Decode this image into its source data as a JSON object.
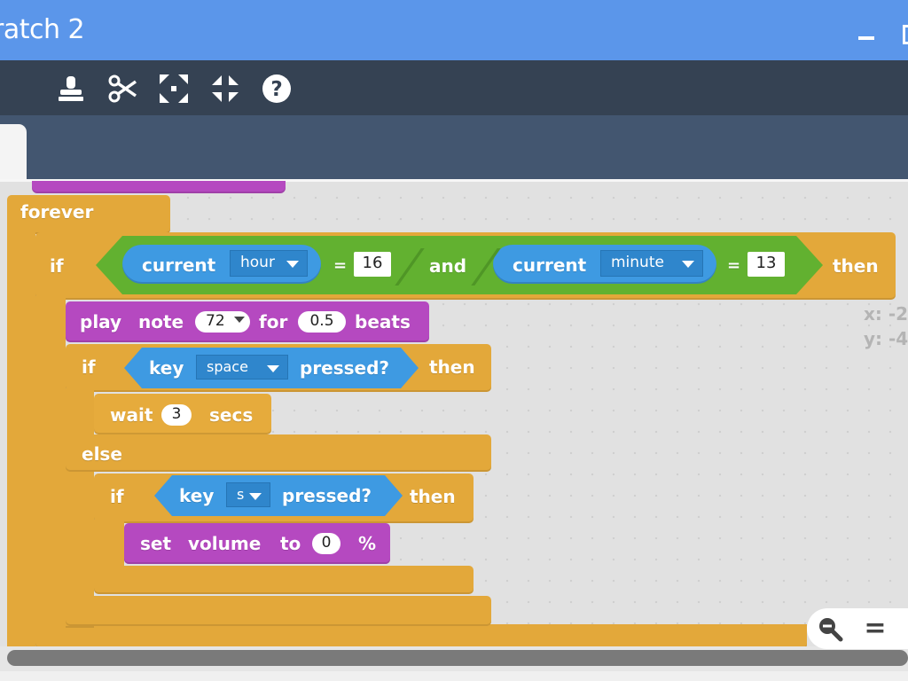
{
  "window": {
    "title": "ratch 2"
  },
  "toolbar": {
    "items": [
      {
        "icon": "stamp-icon",
        "label": "duplicate"
      },
      {
        "icon": "scissors-icon",
        "label": "delete"
      },
      {
        "icon": "grow-icon",
        "label": "grow"
      },
      {
        "icon": "shrink-icon",
        "label": "shrink"
      },
      {
        "icon": "help-icon",
        "label": "help"
      }
    ]
  },
  "script": {
    "forever": {
      "label": "forever"
    },
    "outer_if": {
      "if_label": "if",
      "then_label": "then",
      "cond1": {
        "current_label": "current",
        "unit": "hour",
        "eq": "=",
        "value": "16"
      },
      "and_label": "and",
      "cond2": {
        "current_label": "current",
        "unit": "minute",
        "eq": "=",
        "value": "13"
      }
    },
    "play_note": {
      "play_label": "play",
      "note_label": "note",
      "note_value": "72",
      "for_label": "for",
      "beats_value": "0.5",
      "beats_label": "beats"
    },
    "inner_if": {
      "if_label": "if",
      "key_label": "key",
      "key_value": "space",
      "pressed_label": "pressed?",
      "then_label": "then",
      "else_label": "else"
    },
    "wait": {
      "wait_label": "wait",
      "value": "3",
      "secs_label": "secs"
    },
    "nested_if": {
      "if_label": "if",
      "key_label": "key",
      "key_value": "s",
      "pressed_label": "pressed?",
      "then_label": "then"
    },
    "set_volume": {
      "set_label": "set",
      "volume_label": "volume",
      "to_label": "to",
      "value": "0",
      "percent_label": "%"
    }
  },
  "stage_info": {
    "x_label": "x: -2",
    "y_label": "y: -4"
  },
  "zoom": {
    "reset_label": "="
  },
  "colors": {
    "titlebar": "#5b96ea",
    "toolbar": "#354253",
    "tabrow": "#435670",
    "control": "#e3a83a",
    "sound": "#b549c0",
    "operator": "#62b130",
    "sensing": "#3e9ae2"
  }
}
